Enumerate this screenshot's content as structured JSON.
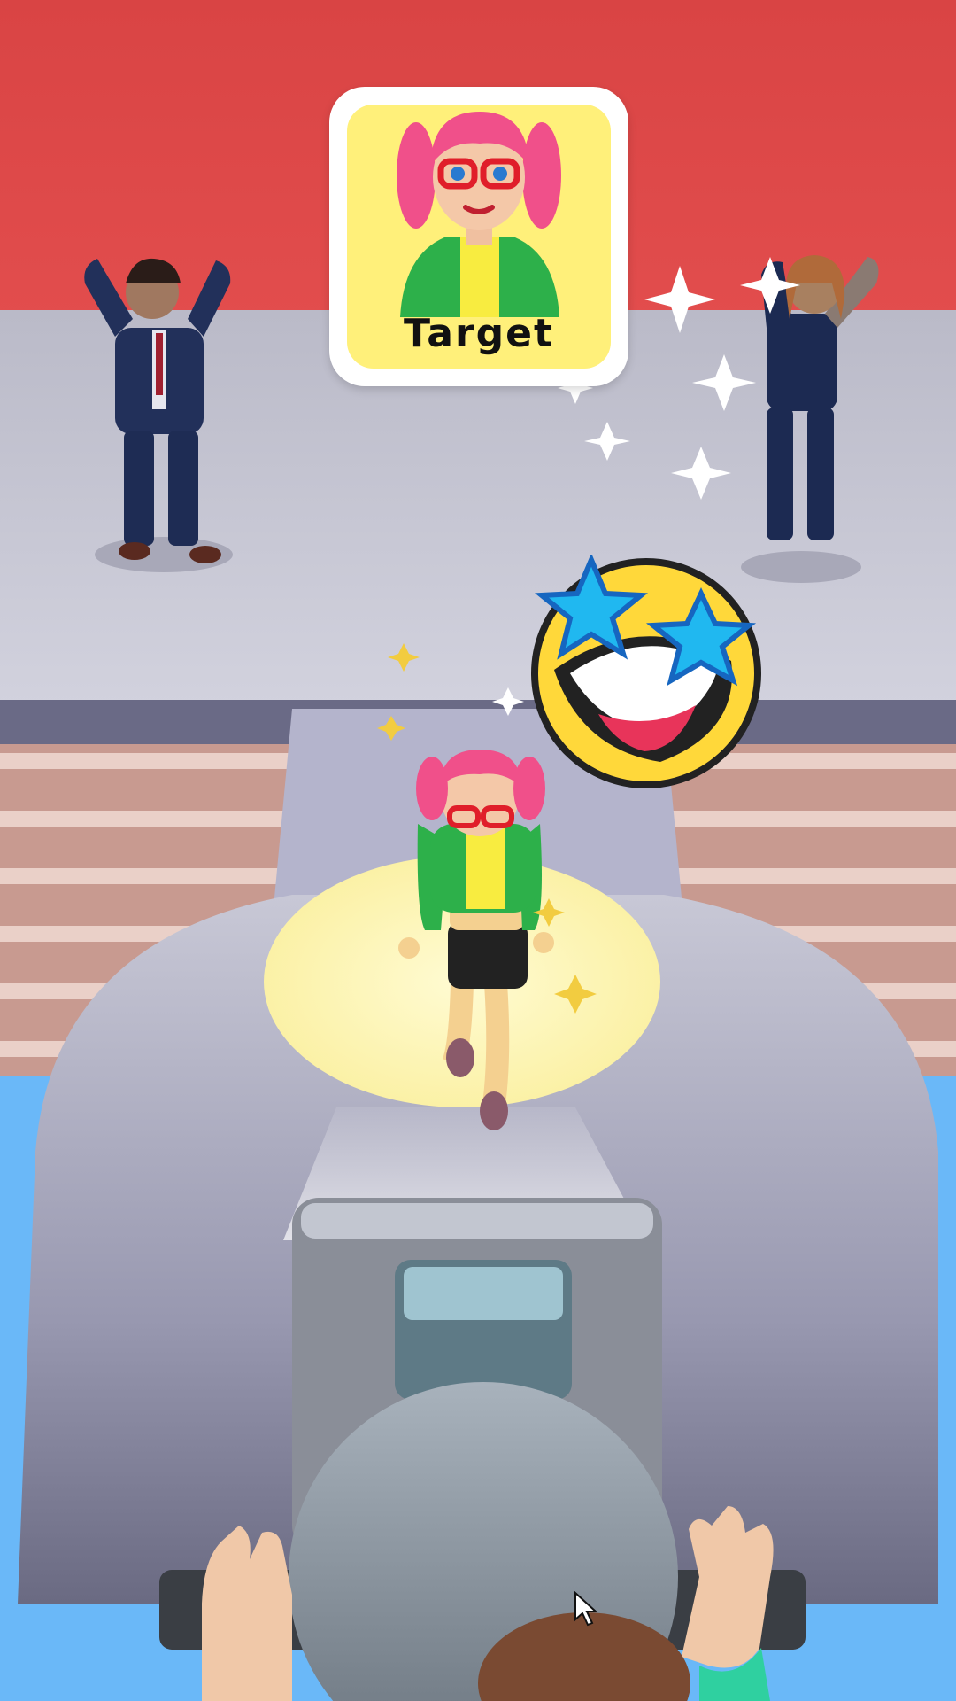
{
  "hud": {
    "target_label": "Target"
  },
  "scene": {
    "target_character": "pink-pigtails-girl-glasses-green-jacket",
    "reaction_emoji": "star-struck-face",
    "colors": {
      "curtain": "#de4848",
      "stage": "#c4c4d2",
      "card_fill": "#fff07a",
      "card_border": "#ffffff",
      "spotlight": "#fff8c0",
      "water": "#6ab8f8",
      "camera_body": "#b8b8c8",
      "emoji_face": "#ffd83a",
      "emoji_star": "#20b8f0"
    }
  }
}
